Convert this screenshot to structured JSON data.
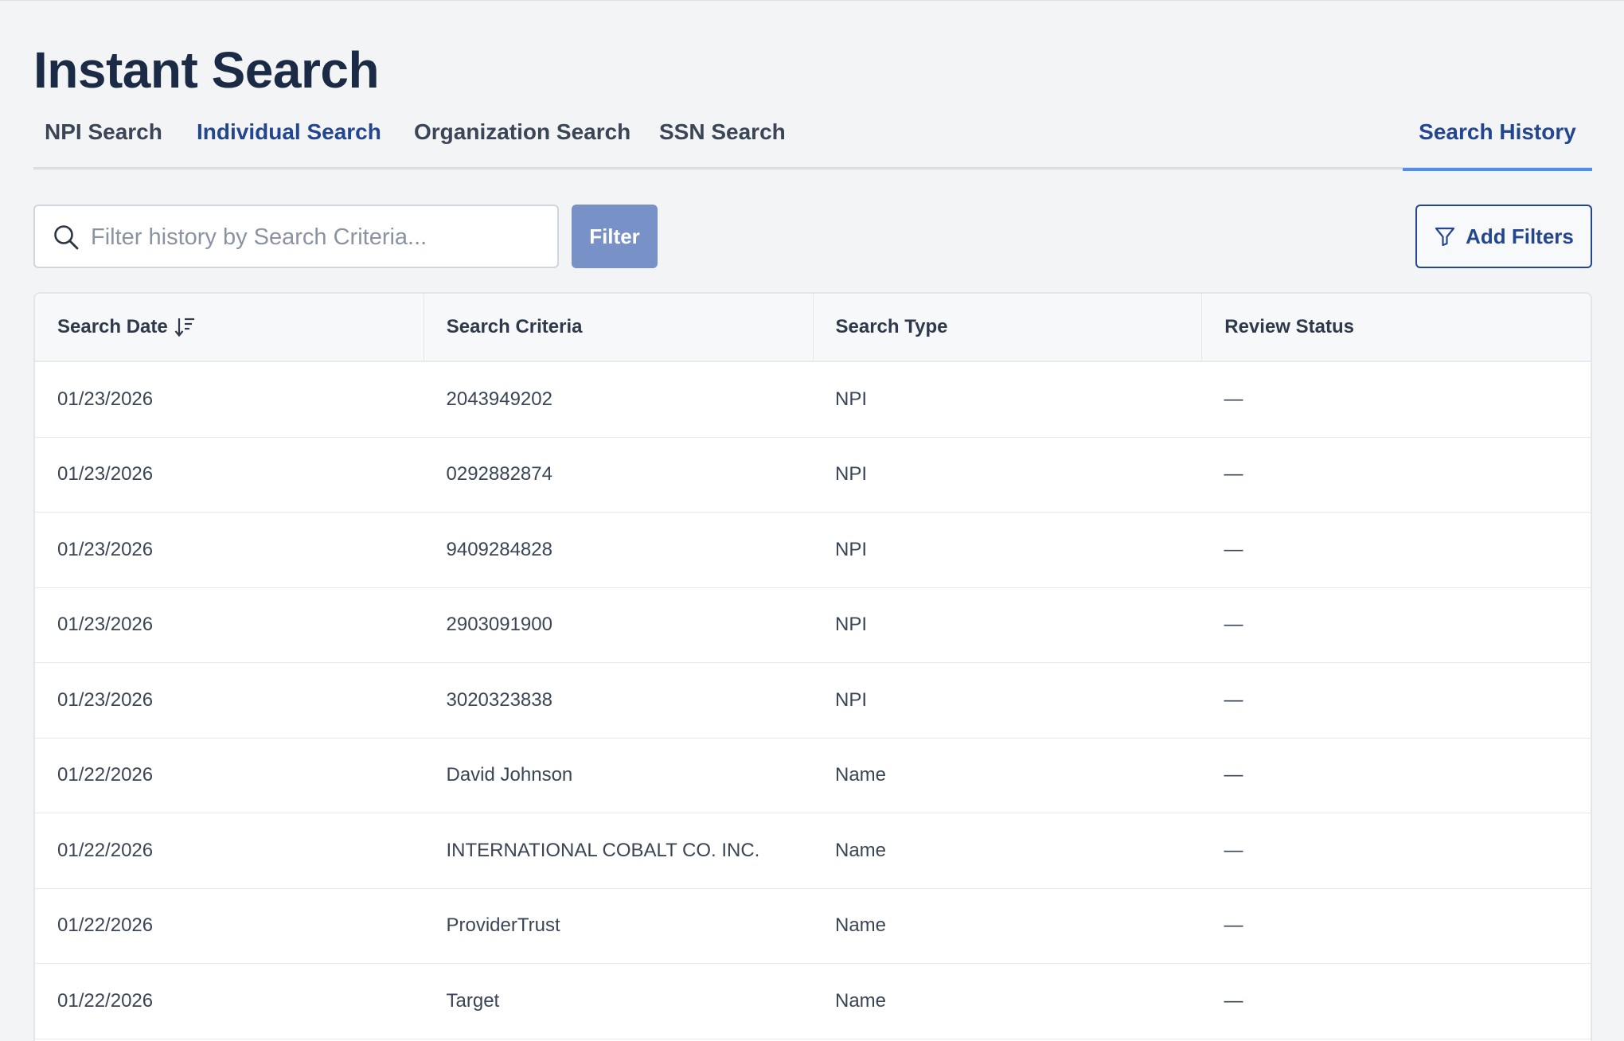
{
  "page": {
    "title": "Instant Search"
  },
  "tabs": [
    {
      "label": "NPI Search"
    },
    {
      "label": "Individual Search"
    },
    {
      "label": "Organization Search"
    },
    {
      "label": "SSN Search"
    },
    {
      "label": "Search History"
    }
  ],
  "toolbar": {
    "search_placeholder": "Filter history by Search Criteria...",
    "search_value": "",
    "filter_label": "Filter",
    "add_filters_label": "Add Filters"
  },
  "table": {
    "columns": [
      "Search Date",
      "Search Criteria",
      "Search Type",
      "Review Status"
    ],
    "rows": [
      {
        "date": "01/23/2026",
        "criteria": "2043949202",
        "type": "NPI",
        "status": "—"
      },
      {
        "date": "01/23/2026",
        "criteria": "0292882874",
        "type": "NPI",
        "status": "—"
      },
      {
        "date": "01/23/2026",
        "criteria": "9409284828",
        "type": "NPI",
        "status": "—"
      },
      {
        "date": "01/23/2026",
        "criteria": "2903091900",
        "type": "NPI",
        "status": "—"
      },
      {
        "date": "01/23/2026",
        "criteria": "3020323838",
        "type": "NPI",
        "status": "—"
      },
      {
        "date": "01/22/2026",
        "criteria": "David Johnson",
        "type": "Name",
        "status": "—"
      },
      {
        "date": "01/22/2026",
        "criteria": "INTERNATIONAL COBALT CO. INC.",
        "type": "Name",
        "status": "—"
      },
      {
        "date": "01/22/2026",
        "criteria": "ProviderTrust",
        "type": "Name",
        "status": "—"
      },
      {
        "date": "01/22/2026",
        "criteria": "Target",
        "type": "Name",
        "status": "—"
      }
    ]
  },
  "colors": {
    "accent": "#23468f",
    "active_underline": "#4d8ff0",
    "filter_button": "#7891c7"
  },
  "icons": {
    "search": "search-icon",
    "funnel": "funnel-icon",
    "sort": "sort-descending-icon"
  }
}
